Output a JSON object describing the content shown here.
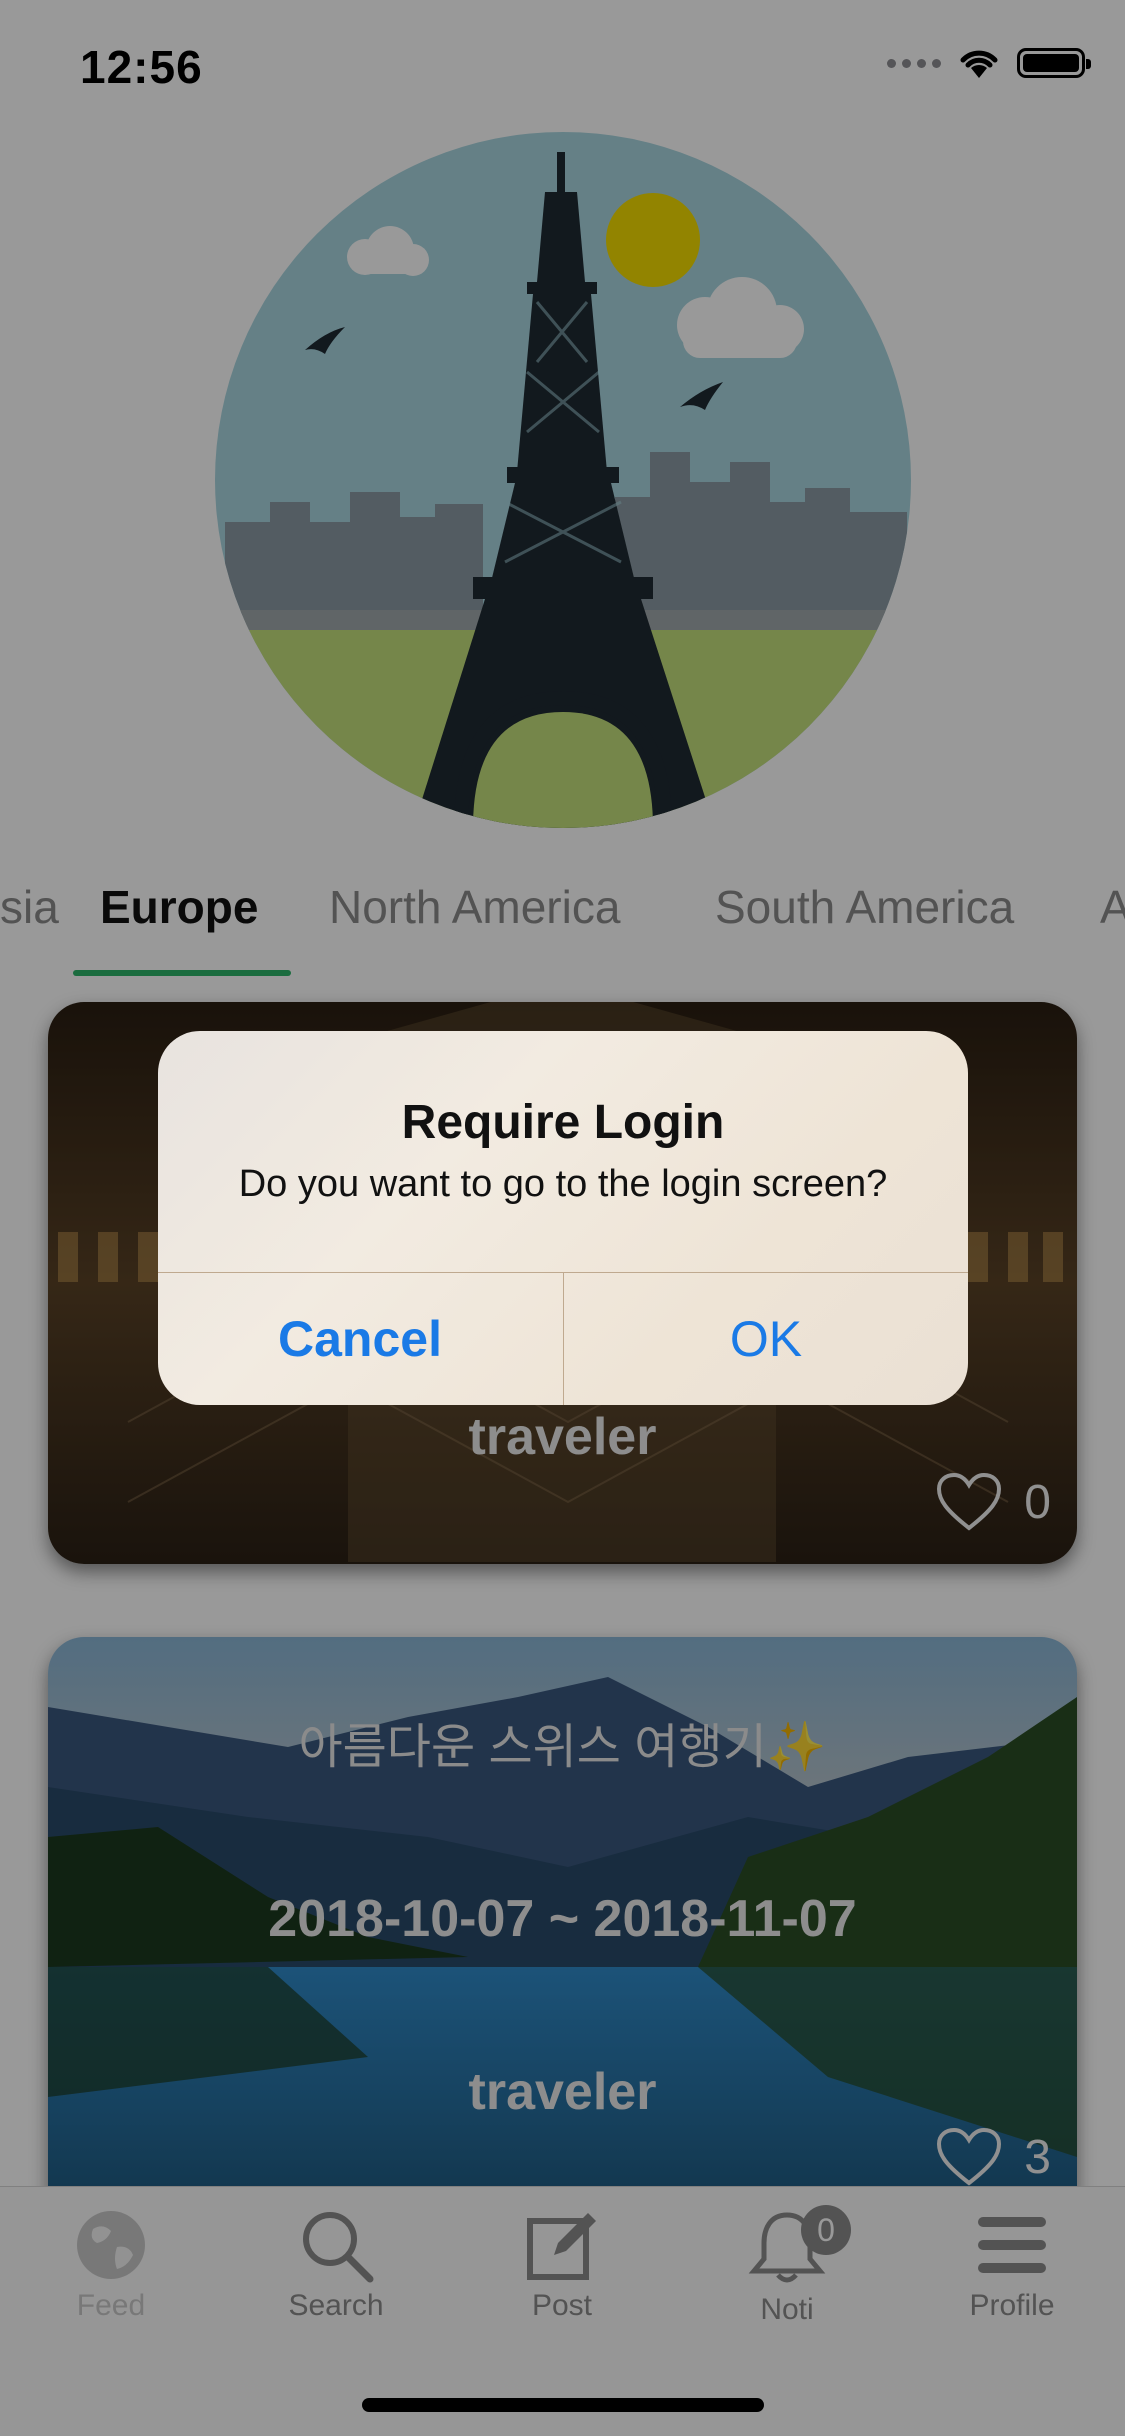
{
  "status_bar": {
    "time": "12:56"
  },
  "hero": {
    "icon": "eiffel-tower-illustration"
  },
  "region_tabs": {
    "items": [
      {
        "label": "sia"
      },
      {
        "label": "Europe"
      },
      {
        "label": "North America"
      },
      {
        "label": "South America"
      },
      {
        "label": "A"
      }
    ],
    "active_index": 1
  },
  "cards": [
    {
      "author": "traveler",
      "likes": "0",
      "image": "louvre-pyramid-night"
    },
    {
      "title": "아름다운 스위스 여행기✨",
      "dates": "2018-10-07 ~ 2018-11-07",
      "author": "traveler",
      "likes": "3",
      "image": "swiss-lake-mountains"
    }
  ],
  "tab_bar": {
    "items": [
      {
        "label": "Feed",
        "icon": "globe-icon"
      },
      {
        "label": "Search",
        "icon": "search-icon"
      },
      {
        "label": "Post",
        "icon": "compose-icon"
      },
      {
        "label": "Noti",
        "icon": "bell-icon",
        "badge": "0"
      },
      {
        "label": "Profile",
        "icon": "menu-icon"
      }
    ]
  },
  "alert": {
    "title": "Require Login",
    "message": "Do you want to go to the login screen?",
    "cancel_label": "Cancel",
    "ok_label": "OK"
  },
  "colors": {
    "accent_green": "#2db56a",
    "alert_button_blue": "#1a7ae6",
    "scrim": "rgba(0,0,0,0.40)"
  }
}
